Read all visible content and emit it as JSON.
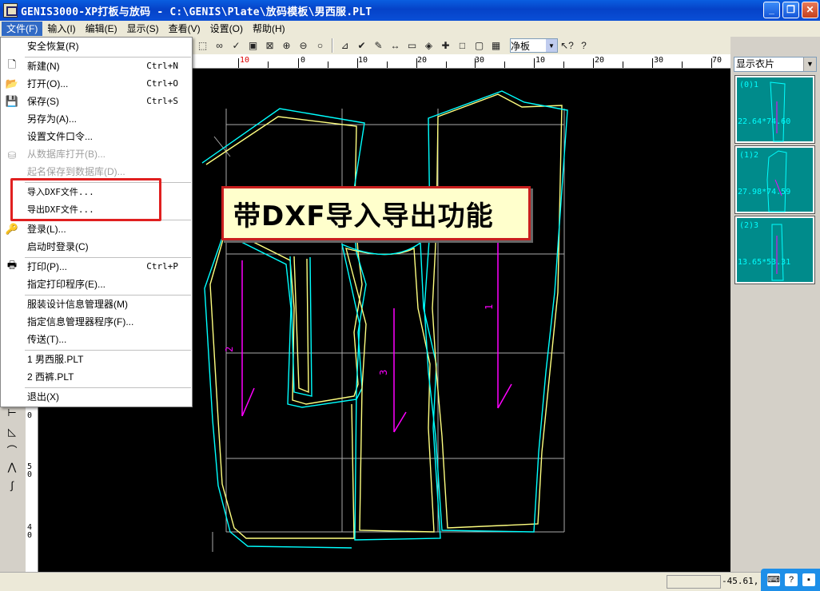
{
  "window": {
    "title": "GENIS3000-XP打板与放码 - C:\\GENIS\\Plate\\放码模板\\男西服.PLT",
    "min": "_",
    "max": "❐",
    "close": "✕"
  },
  "menubar": {
    "items": [
      "文件(F)",
      "输入(I)",
      "编辑(E)",
      "显示(S)",
      "查看(V)",
      "设置(O)",
      "帮助(H)"
    ]
  },
  "toolbar": {
    "board_select": "净板"
  },
  "ruler_top": {
    "labels": [
      "10",
      "0",
      "10",
      "20",
      "30",
      "10",
      "20",
      "30",
      "40",
      "50",
      "60",
      "70"
    ]
  },
  "ruler_left": {
    "labels": [
      "0",
      "5",
      "4",
      "0"
    ]
  },
  "file_menu": {
    "recovery": "安全恢复(R)",
    "new": "新建(N)",
    "new_sc": "Ctrl+N",
    "open": "打开(O)...",
    "open_sc": "Ctrl+O",
    "save": "保存(S)",
    "save_sc": "Ctrl+S",
    "save_as": "另存为(A)...",
    "set_password": "设置文件口令...",
    "open_db": "从数据库打开(B)...",
    "save_db": "起名保存到数据库(D)...",
    "import_dxf": "导入DXF文件...",
    "export_dxf": "导出DXF文件...",
    "login": "登录(L)...",
    "login_startup": "启动时登录(C)",
    "print": "打印(P)...",
    "print_sc": "Ctrl+P",
    "printer": "指定打印程序(E)...",
    "costume_mgr": "服装设计信息管理器(M)",
    "info_mgr_prog": "指定信息管理器程序(F)...",
    "send": "传送(T)...",
    "recent1": "1 男西服.PLT",
    "recent2": "2 西裤.PLT",
    "exit": "退出(X)"
  },
  "callout": {
    "text": "带DXF导入导出功能"
  },
  "right_panel": {
    "show_select": "显示衣片",
    "pieces": [
      {
        "id": "(0)1",
        "dim": "22.64*74.60"
      },
      {
        "id": "(1)2",
        "dim": "27.98*74.59"
      },
      {
        "id": "(2)3",
        "dim": "13.65*53.31"
      }
    ]
  },
  "canvas_labels": {
    "piece1": "1",
    "piece2": "2",
    "piece3": "3"
  },
  "status": {
    "coord": "-45.61, 1"
  },
  "colors": {
    "canvas": "#000000",
    "pattern_cyan": "#00ffff",
    "pattern_yellow": "#ffff80",
    "grain_magenta": "#ff00ff",
    "highlight_red": "#e02020",
    "thumb_bg": "#008b8b"
  }
}
